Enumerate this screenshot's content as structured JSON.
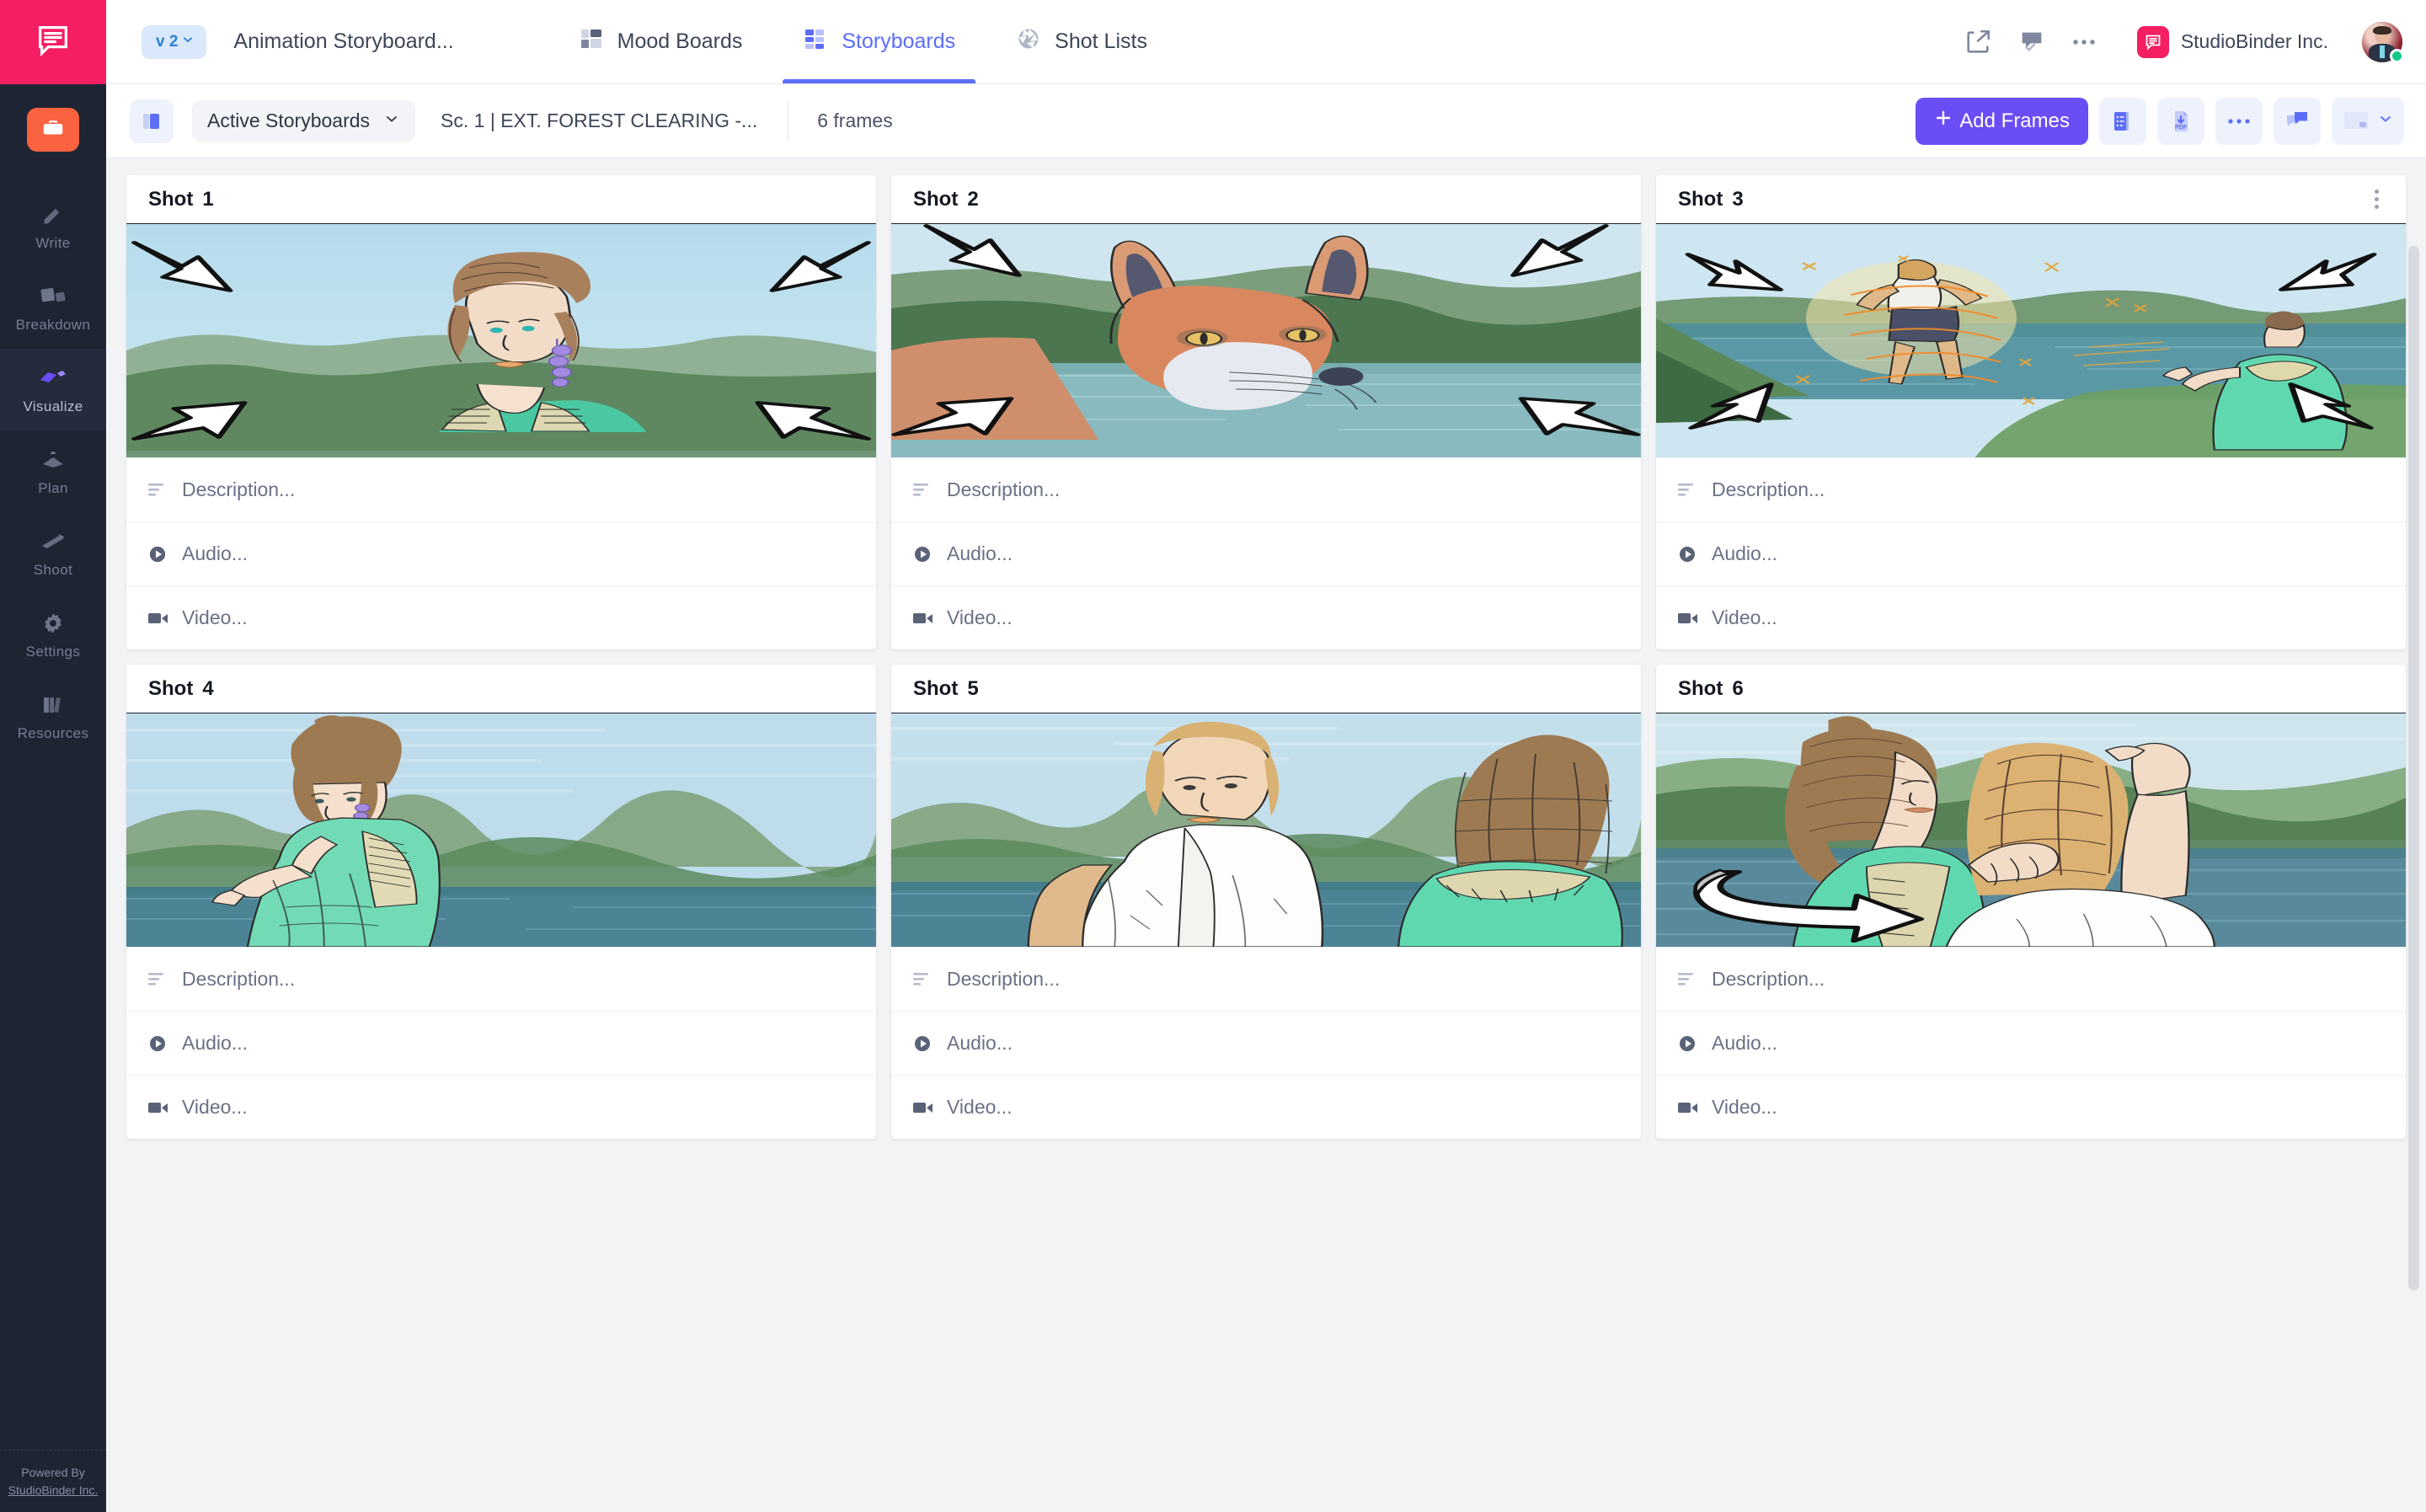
{
  "app": {
    "brand": "StudioBinder",
    "logo_icon": "studiobinder-speech-bubble-icon"
  },
  "rail": {
    "project_icon": "briefcase-icon",
    "items": [
      {
        "label": "Write",
        "icon": "pencil-icon",
        "active": false
      },
      {
        "label": "Breakdown",
        "icon": "grid-pages-icon",
        "active": false
      },
      {
        "label": "Visualize",
        "icon": "shapes-icon",
        "active": true
      },
      {
        "label": "Plan",
        "icon": "calendar-icon",
        "active": false
      },
      {
        "label": "Shoot",
        "icon": "clapboard-icon",
        "active": false
      },
      {
        "label": "Settings",
        "icon": "gear-icon",
        "active": false
      },
      {
        "label": "Resources",
        "icon": "books-icon",
        "active": false
      }
    ],
    "footer_line1": "Powered By",
    "footer_line2": "StudioBinder Inc."
  },
  "topbar": {
    "version_label": "v 2",
    "version_caret_icon": "chevron-down-icon",
    "document_title": "Animation Storyboard...",
    "tabs": [
      {
        "label": "Mood Boards",
        "icon": "mood-board-icon",
        "active": false
      },
      {
        "label": "Storyboards",
        "icon": "storyboard-grid-icon",
        "active": true
      },
      {
        "label": "Shot Lists",
        "icon": "aperture-icon",
        "active": false
      }
    ],
    "actions": [
      {
        "name": "share-icon"
      },
      {
        "name": "comment-approve-icon"
      },
      {
        "name": "more-horizontal-icon"
      }
    ],
    "org_name": "StudioBinder Inc.",
    "org_logo_icon": "studiobinder-logo-icon",
    "avatar_name": "user-avatar",
    "status": "online"
  },
  "subbar": {
    "panel_toggle_icon": "side-panel-icon",
    "board_filter_label": "Active Storyboards",
    "board_filter_caret_icon": "chevron-down-icon",
    "scene_name": "Sc. 1 | EXT. FOREST CLEARING -...",
    "frames_count": "6 frames",
    "add_frames_label": "Add Frames",
    "add_frames_plus_icon": "plus-icon",
    "tools": [
      {
        "name": "shot-list-icon"
      },
      {
        "name": "pdf-download-icon"
      },
      {
        "name": "more-horizontal-icon"
      },
      {
        "name": "comments-icon"
      },
      {
        "name": "frame-size-icon"
      }
    ],
    "tool_caret_icon": "chevron-down-icon",
    "accent_color": "#6a4df5"
  },
  "board": {
    "row_labels": {
      "description": "Description...",
      "audio": "Audio...",
      "video": "Video..."
    },
    "row_icons": {
      "description": "text-lines-icon",
      "audio": "play-circle-icon",
      "video": "video-camera-icon"
    },
    "kebab_icon": "more-vertical-icon",
    "cards": [
      {
        "title": "Shot",
        "number": "1",
        "art": "woman-portrait-4arrows",
        "kebab": false
      },
      {
        "title": "Shot",
        "number": "2",
        "art": "fox-portrait-4arrows",
        "kebab": false
      },
      {
        "title": "Shot",
        "number": "3",
        "art": "magic-man-woman-4arrows",
        "kebab": true
      },
      {
        "title": "Shot",
        "number": "4",
        "art": "woman-gesture",
        "kebab": false
      },
      {
        "title": "Shot",
        "number": "5",
        "art": "man-and-woman-back",
        "kebab": false
      },
      {
        "title": "Shot",
        "number": "6",
        "art": "couple-circle-arrow",
        "kebab": false
      }
    ]
  }
}
